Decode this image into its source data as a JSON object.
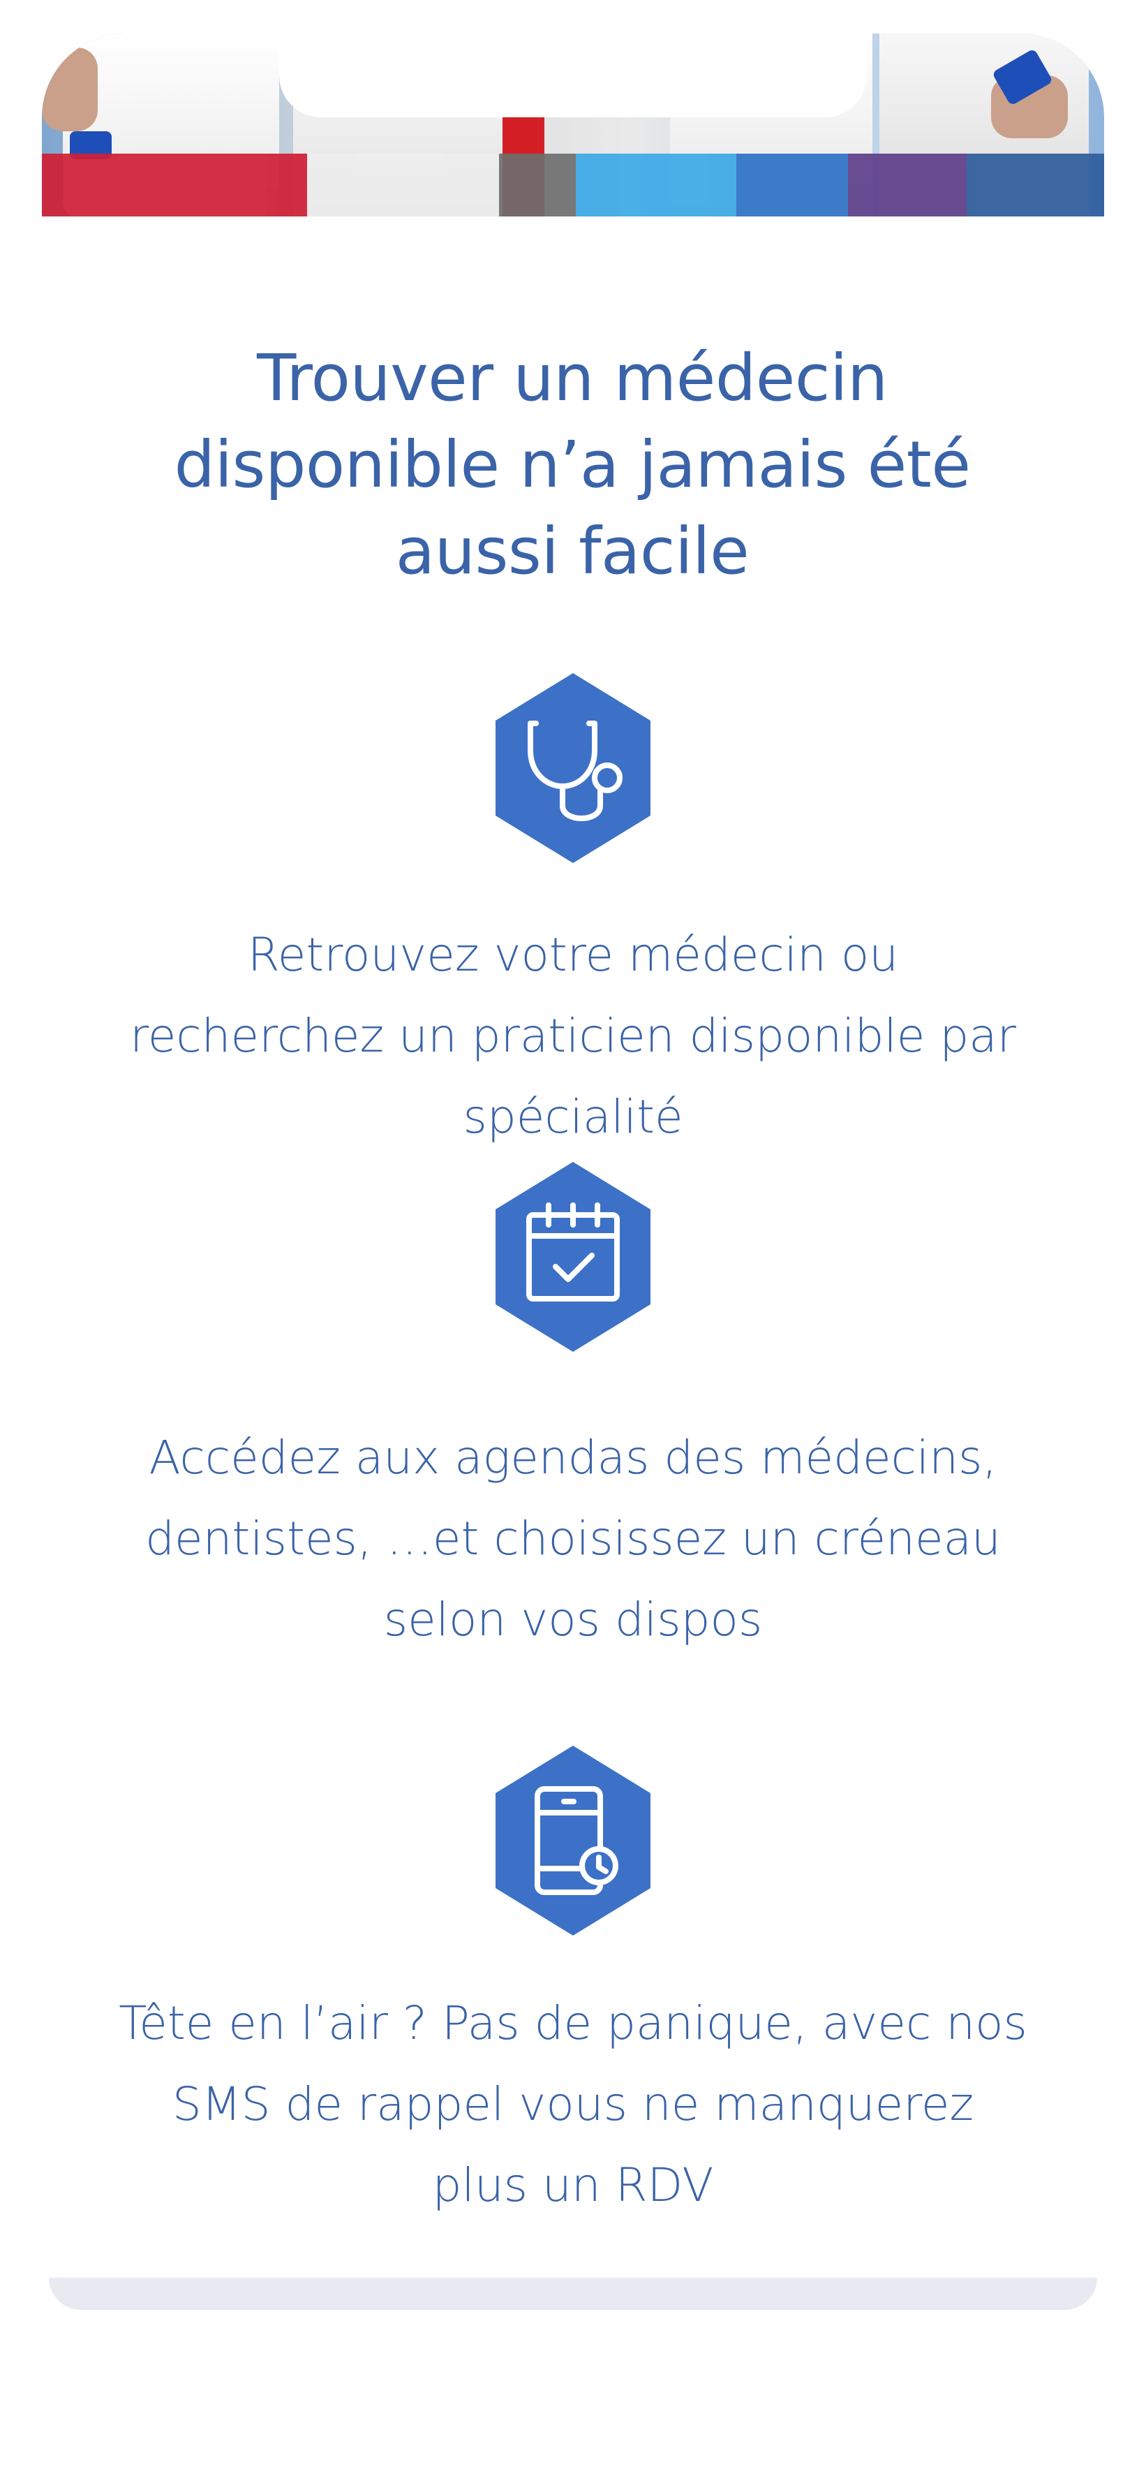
{
  "header": {
    "image_icon": "doctors-team-banner"
  },
  "main": {
    "title": "Trouver un médecin disponible n’a jamais été aussi facile",
    "features": [
      {
        "icon": "stethoscope-icon",
        "text": "Retrouvez votre médecin ou recherchez un praticien disponible par spécialité"
      },
      {
        "icon": "calendar-check-icon",
        "text": "Accédez aux agendas des médecins, dentistes, …et choisissez un créneau selon vos dispos"
      },
      {
        "icon": "phone-clock-icon",
        "text": "Tête en l’air ? Pas de panique, avec nos SMS de rappel vous ne manquerez plus un RDV"
      }
    ]
  },
  "colors": {
    "accent_blue": "#3a63a8",
    "icon_blue": "#3d71c7",
    "background": "#ffffff"
  }
}
